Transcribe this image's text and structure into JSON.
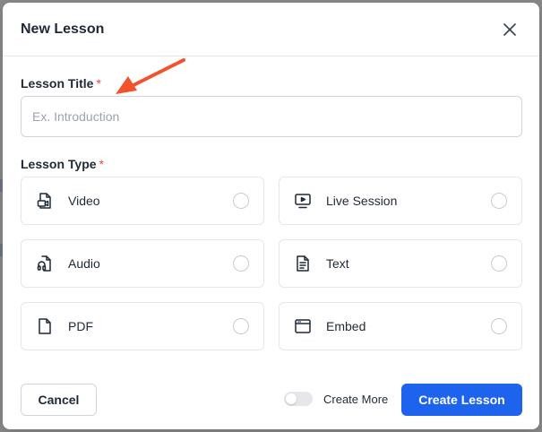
{
  "modal": {
    "title": "New Lesson",
    "close_icon": "close-icon"
  },
  "lesson_title": {
    "label": "Lesson Title",
    "required_mark": "*",
    "placeholder": "Ex. Introduction",
    "value": ""
  },
  "lesson_type": {
    "label": "Lesson Type",
    "required_mark": "*",
    "options": [
      {
        "label": "Video",
        "icon": "video-file-icon",
        "selected": false
      },
      {
        "label": "Live Session",
        "icon": "screen-play-icon",
        "selected": false
      },
      {
        "label": "Audio",
        "icon": "audio-file-icon",
        "selected": false
      },
      {
        "label": "Text",
        "icon": "text-file-icon",
        "selected": false
      },
      {
        "label": "PDF",
        "icon": "pdf-file-icon",
        "selected": false
      },
      {
        "label": "Embed",
        "icon": "browser-window-icon",
        "selected": false
      }
    ]
  },
  "footer": {
    "cancel_label": "Cancel",
    "create_more_label": "Create More",
    "create_more_enabled": false,
    "create_label": "Create Lesson"
  },
  "colors": {
    "primary": "#1d63ed",
    "required": "#ef4444",
    "annotation_arrow": "#f0532e"
  }
}
